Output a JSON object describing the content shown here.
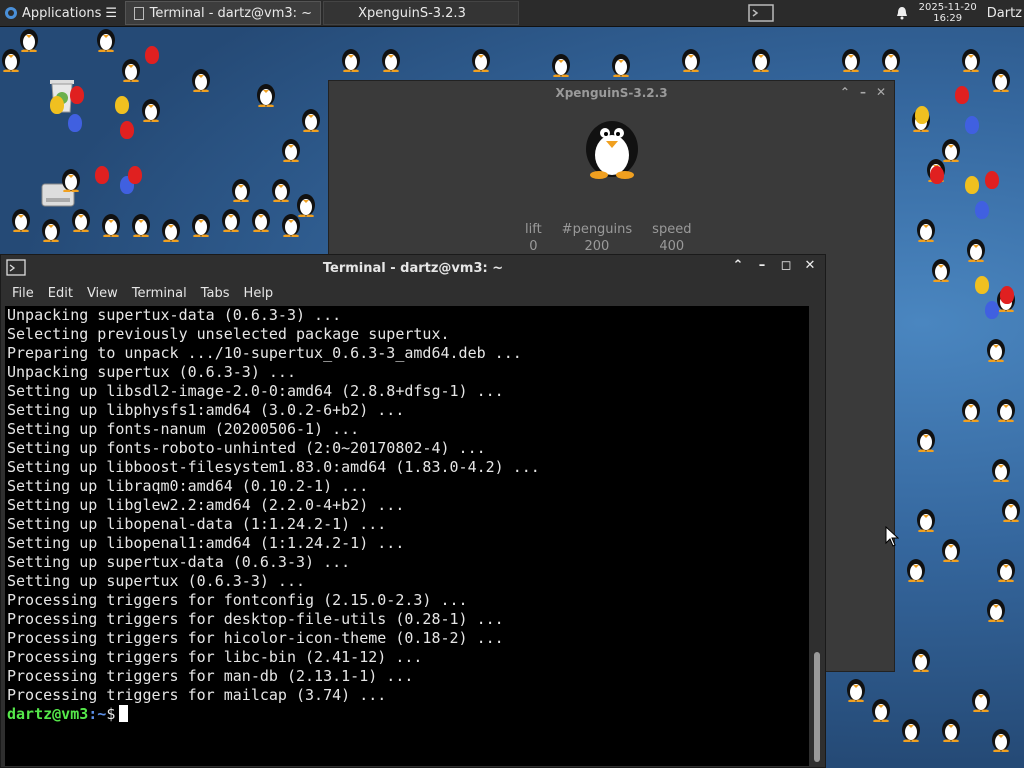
{
  "panel": {
    "apps_label": "Applications",
    "tasks": [
      {
        "label": "Terminal - dartz@vm3: ~",
        "active": true
      },
      {
        "label": "XpenguinS-3.2.3",
        "active": false
      }
    ],
    "clock_date": "2025-11-20",
    "clock_time": "16:29",
    "user": "Dartz"
  },
  "xpenguins": {
    "title": "XpenguinS-3.2.3",
    "stats": [
      {
        "label": "lift",
        "value": "0"
      },
      {
        "label": "#penguins",
        "value": "200"
      },
      {
        "label": "speed",
        "value": "400"
      }
    ]
  },
  "terminal": {
    "title": "Terminal - dartz@vm3: ~",
    "menu": [
      "File",
      "Edit",
      "View",
      "Terminal",
      "Tabs",
      "Help"
    ],
    "lines": [
      "Unpacking supertux-data (0.6.3-3) ...",
      "Selecting previously unselected package supertux.",
      "Preparing to unpack .../10-supertux_0.6.3-3_amd64.deb ...",
      "Unpacking supertux (0.6.3-3) ...",
      "Setting up libsdl2-image-2.0-0:amd64 (2.8.8+dfsg-1) ...",
      "Setting up libphysfs1:amd64 (3.0.2-6+b2) ...",
      "Setting up fonts-nanum (20200506-1) ...",
      "Setting up fonts-roboto-unhinted (2:0~20170802-4) ...",
      "Setting up libboost-filesystem1.83.0:amd64 (1.83.0-4.2) ...",
      "Setting up libraqm0:amd64 (0.10.2-1) ...",
      "Setting up libglew2.2:amd64 (2.2.0-4+b2) ...",
      "Setting up libopenal-data (1:1.24.2-1) ...",
      "Setting up libopenal1:amd64 (1:1.24.2-1) ...",
      "Setting up supertux-data (0.6.3-3) ...",
      "Setting up supertux (0.6.3-3) ...",
      "Processing triggers for fontconfig (2.15.0-2.3) ...",
      "Processing triggers for desktop-file-utils (0.28-1) ...",
      "Processing triggers for hicolor-icon-theme (0.18-2) ...",
      "Processing triggers for libc-bin (2.41-12) ...",
      "Processing triggers for man-db (2.13.1-1) ...",
      "Processing triggers for mailcap (3.74) ..."
    ],
    "prompt_user": "dartz@vm3",
    "prompt_path": ":~",
    "prompt_symbol": "$"
  },
  "colors": {
    "prompt_user": "#55e84a",
    "prompt_path": "#5c8fe6",
    "panel_bg": "#2b2b2b",
    "desktop_bg": "#2e5a8c"
  }
}
